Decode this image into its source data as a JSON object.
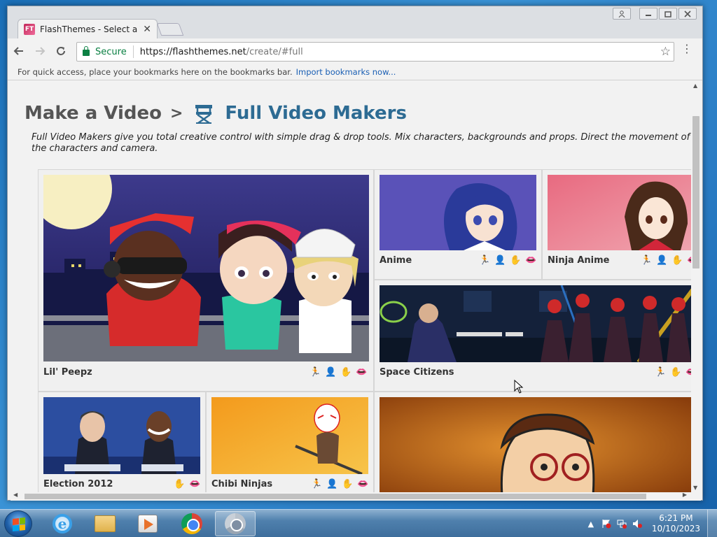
{
  "browser": {
    "tab": {
      "favicon": "FT",
      "title": "FlashThemes - Select a Th",
      "close": "✕"
    },
    "window_controls": [
      "user-icon",
      "minimize-icon",
      "restore-icon",
      "close-icon"
    ],
    "address": {
      "secure_label": "Secure",
      "url_host": "https://flashthemes.net",
      "url_path": "/create/#full"
    },
    "bookmarks_bar": {
      "text": "For quick access, place your bookmarks here on the bookmarks bar.",
      "link": "Import bookmarks now..."
    }
  },
  "page": {
    "breadcrumb": "Make a Video",
    "breadcrumb_separator": ">",
    "title": "Full Video Makers",
    "title_icon": "director-chair-icon",
    "description": "Full Video Makers give you total creative control with simple drag & drop tools. Mix characters, backgrounds and props. Direct the movement of the characters and camera.",
    "themes": [
      {
        "name": "Lil' Peepz",
        "features": [
          "action-icon",
          "character-icon",
          "hand-icon",
          "lipsync-icon"
        ]
      },
      {
        "name": "Anime",
        "features": [
          "action-icon",
          "character-icon",
          "hand-icon",
          "lipsync-icon"
        ]
      },
      {
        "name": "Ninja Anime",
        "features": [
          "action-icon",
          "character-icon",
          "hand-icon",
          "lipsync-icon"
        ]
      },
      {
        "name": "Space Citizens",
        "features": [
          "action-icon",
          "hand-icon",
          "lipsync-icon"
        ]
      },
      {
        "name": "Election 2012",
        "features": [
          "hand-icon",
          "lipsync-icon"
        ]
      },
      {
        "name": "Chibi Ninjas",
        "features": [
          "action-icon",
          "character-icon",
          "hand-icon",
          "lipsync-icon"
        ]
      },
      {
        "name": "",
        "features": []
      }
    ]
  },
  "taskbar": {
    "apps": [
      "internet-explorer-icon",
      "file-explorer-icon",
      "media-player-icon",
      "chrome-icon",
      "chrome-active-icon"
    ],
    "clock": {
      "time": "6:21 PM",
      "date": "10/10/2023"
    }
  },
  "colors": {
    "title_blue": "#2d6b93",
    "secure_green": "#0b8043",
    "link_blue": "#1a5fb4"
  }
}
